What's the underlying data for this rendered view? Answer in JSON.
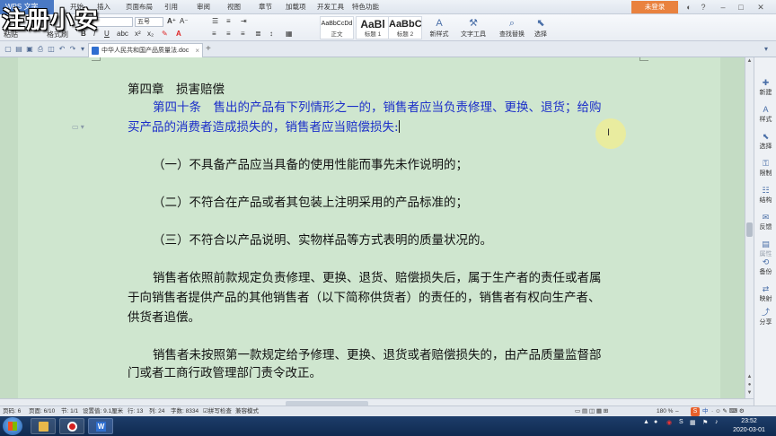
{
  "watermark": "注册小安",
  "menu": {
    "brand": "WPS 文字",
    "items": [
      "开始",
      "插入",
      "页面布局",
      "引用",
      "审阅",
      "视图",
      "章节",
      "加载项",
      "开发工具",
      "特色功能"
    ],
    "login": "未登录"
  },
  "ribbon": {
    "paste": "粘贴",
    "brush": "格式刷",
    "font_size": "五号",
    "styles": [
      {
        "sample": "AaBbCcDd",
        "name": "正文"
      },
      {
        "sample": "AaBl",
        "name": "标题 1"
      },
      {
        "sample": "AaBbC",
        "name": "标题 2"
      }
    ],
    "new_style": "新样式",
    "text_tools": "文字工具",
    "find_replace": "查找替换",
    "select": "选择"
  },
  "document": {
    "tab_title": "中华人民共和国产品质量法.doc",
    "heading": "第四章　损害赔偿",
    "article_line1": "第四十条　售出的产品有下列情形之一的，销售者应当负责修理、更换、退货；给购",
    "article_line2": "买产品的消费者造成损失的，销售者应当赔偿损失:",
    "item1": "（一）不具备产品应当具备的使用性能而事先未作说明的；",
    "item2": "（二）不符合在产品或者其包装上注明采用的产品标准的；",
    "item3": "（三）不符合以产品说明、实物样品等方式表明的质量状况的。",
    "para1_line1": "销售者依照前款规定负责修理、更换、退货、赔偿损失后，属于生产者的责任或者属",
    "para1_line2": "于向销售者提供产品的其他销售者（以下简称供货者）的责任的，销售者有权向生产者、",
    "para1_line3": "供货者追偿。",
    "para2_line1": "销售者未按照第一款规定给予修理、更换、退货或者赔偿损失的，由产品质量监督部",
    "para2_line2": "门或者工商行政管理部门责令改正。"
  },
  "side_panel": [
    "新建",
    "样式",
    "选择",
    "限制",
    "结构",
    "反馈",
    "属性",
    "备份",
    "映射",
    "分享"
  ],
  "status": {
    "page_no": "页码: 6",
    "page": "页面: 6/10",
    "section": "节: 1/1",
    "position": "设置值: 9.1厘米",
    "row": "行: 13",
    "col": "列: 24",
    "word_count": "字数: 8334",
    "spell_check": "拼写检查",
    "compat_mode": "兼容模式",
    "zoom": "180 %"
  },
  "taskbar": {
    "time": "23:52",
    "date": "2020-03-01"
  },
  "colors": {
    "page_bg": "#cfe6cf",
    "selected_text": "#1c2fc9",
    "brand_blue": "#4a79c4",
    "login_orange": "#e9823f"
  }
}
